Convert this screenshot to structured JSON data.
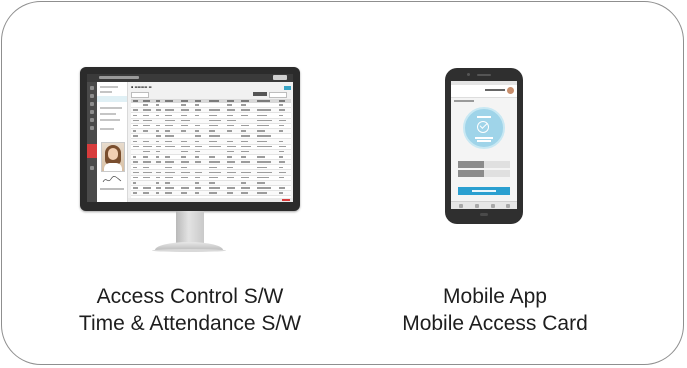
{
  "left_product": {
    "line1": "Access Control S/W",
    "line2": "Time & Attendance S/W"
  },
  "right_product": {
    "line1": "Mobile App",
    "line2": "Mobile Access Card"
  },
  "colors": {
    "card_border": "#8f8f8f",
    "monitor_frame": "#2b2b2b",
    "app_accent_red": "#d73c3c",
    "app_accent_blue": "#39a4c4",
    "phone_circle": "#9fd4e9",
    "phone_action": "#2a9fd0"
  },
  "icons": [
    "monitor-icon",
    "smartphone-icon",
    "check-icon",
    "avatar-icon"
  ]
}
